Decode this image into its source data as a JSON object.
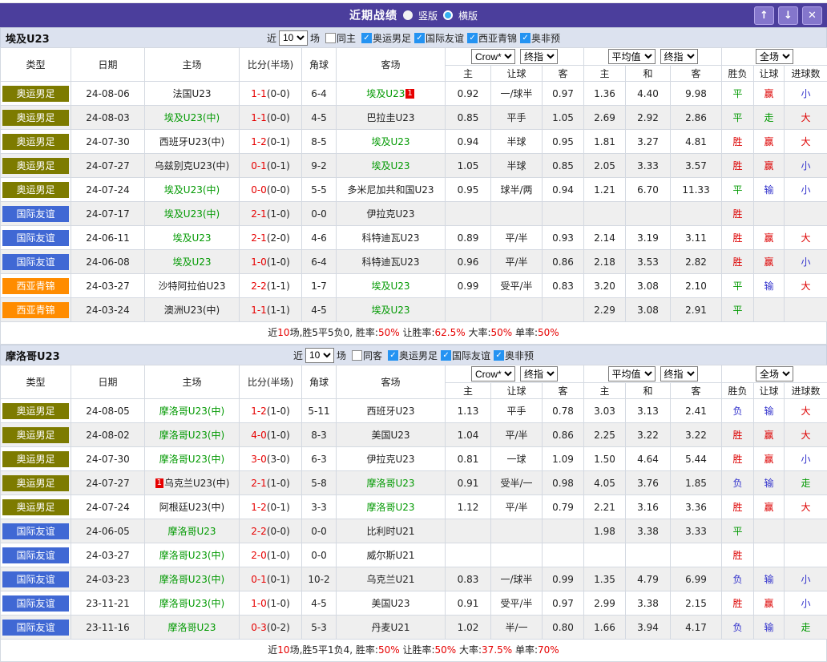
{
  "titlebar": {
    "title": "近期战绩",
    "vertical_label": "竖版",
    "horizontal_label": "横版",
    "up_icon": "↑",
    "down_icon": "↓",
    "close_icon": "✕"
  },
  "headers": {
    "type": "类型",
    "date": "日期",
    "home": "主场",
    "score": "比分(半场)",
    "corner": "角球",
    "away": "客场",
    "asian_home": "主",
    "asian_handicap": "让球",
    "asian_away": "客",
    "euro_home": "主",
    "euro_draw": "和",
    "euro_away": "客",
    "result_wdl": "胜负",
    "result_handicap": "让球",
    "result_goals": "进球数",
    "bookmaker_select": "Crow*",
    "final_select": "终指",
    "average_select": "平均值",
    "final_select2": "终指",
    "scope_select": "全场"
  },
  "filter_common": {
    "near": "近",
    "count": "10",
    "games": "场"
  },
  "result_colors": {
    "胜": "#dd0000",
    "平": "#009900",
    "负": "#3333cc",
    "赢": "#dd0000",
    "走": "#009900",
    "输": "#3333cc",
    "大": "#dd0000",
    "小": "#3333cc"
  },
  "type_colors": {
    "奥运男足": "#7d7b00",
    "国际友谊": "#4068d4",
    "西亚青锦": "#ff8c00"
  },
  "sections": [
    {
      "team": "埃及U23",
      "same_checkbox": {
        "label": "同主",
        "checked": false
      },
      "league_checkboxes": [
        {
          "label": "奥运男足",
          "checked": true
        },
        {
          "label": "国际友谊",
          "checked": true
        },
        {
          "label": "西亚青锦",
          "checked": true
        },
        {
          "label": "奥非预",
          "checked": true
        }
      ],
      "rows": [
        {
          "type": "奥运男足",
          "date": "24-08-06",
          "home": "法国U23",
          "home_green": false,
          "score": "1-1",
          "half": "(0-0)",
          "corner": "6-4",
          "away": "埃及U23",
          "away_green": true,
          "away_badge": "1",
          "asian": [
            "0.92",
            "一/球半",
            "0.97"
          ],
          "euro": [
            "1.36",
            "4.40",
            "9.98"
          ],
          "results": [
            "平",
            "赢",
            "小"
          ]
        },
        {
          "type": "奥运男足",
          "date": "24-08-03",
          "home": "埃及U23(中)",
          "home_green": true,
          "score": "1-1",
          "half": "(0-0)",
          "corner": "4-5",
          "away": "巴拉圭U23",
          "away_green": false,
          "asian": [
            "0.85",
            "平手",
            "1.05"
          ],
          "euro": [
            "2.69",
            "2.92",
            "2.86"
          ],
          "results": [
            "平",
            "走",
            "大"
          ]
        },
        {
          "type": "奥运男足",
          "date": "24-07-30",
          "home": "西班牙U23(中)",
          "home_green": false,
          "score": "1-2",
          "half": "(0-1)",
          "corner": "8-5",
          "away": "埃及U23",
          "away_green": true,
          "asian": [
            "0.94",
            "半球",
            "0.95"
          ],
          "euro": [
            "1.81",
            "3.27",
            "4.81"
          ],
          "results": [
            "胜",
            "赢",
            "大"
          ]
        },
        {
          "type": "奥运男足",
          "date": "24-07-27",
          "home": "乌兹别克U23(中)",
          "home_green": false,
          "score": "0-1",
          "half": "(0-1)",
          "corner": "9-2",
          "away": "埃及U23",
          "away_green": true,
          "asian": [
            "1.05",
            "半球",
            "0.85"
          ],
          "euro": [
            "2.05",
            "3.33",
            "3.57"
          ],
          "results": [
            "胜",
            "赢",
            "小"
          ]
        },
        {
          "type": "奥运男足",
          "date": "24-07-24",
          "home": "埃及U23(中)",
          "home_green": true,
          "score": "0-0",
          "half": "(0-0)",
          "corner": "5-5",
          "away": "多米尼加共和国U23",
          "away_green": false,
          "asian": [
            "0.95",
            "球半/两",
            "0.94"
          ],
          "euro": [
            "1.21",
            "6.70",
            "11.33"
          ],
          "results": [
            "平",
            "输",
            "小"
          ]
        },
        {
          "type": "国际友谊",
          "date": "24-07-17",
          "home": "埃及U23(中)",
          "home_green": true,
          "score": "2-1",
          "half": "(1-0)",
          "corner": "0-0",
          "away": "伊拉克U23",
          "away_green": false,
          "asian": [
            "",
            "",
            ""
          ],
          "euro": [
            "",
            "",
            ""
          ],
          "results": [
            "胜",
            "",
            ""
          ]
        },
        {
          "type": "国际友谊",
          "date": "24-06-11",
          "home": "埃及U23",
          "home_green": true,
          "score": "2-1",
          "half": "(2-0)",
          "corner": "4-6",
          "away": "科特迪瓦U23",
          "away_green": false,
          "asian": [
            "0.89",
            "平/半",
            "0.93"
          ],
          "euro": [
            "2.14",
            "3.19",
            "3.11"
          ],
          "results": [
            "胜",
            "赢",
            "大"
          ]
        },
        {
          "type": "国际友谊",
          "date": "24-06-08",
          "home": "埃及U23",
          "home_green": true,
          "score": "1-0",
          "half": "(1-0)",
          "corner": "6-4",
          "away": "科特迪瓦U23",
          "away_green": false,
          "asian": [
            "0.96",
            "平/半",
            "0.86"
          ],
          "euro": [
            "2.18",
            "3.53",
            "2.82"
          ],
          "results": [
            "胜",
            "赢",
            "小"
          ]
        },
        {
          "type": "西亚青锦",
          "date": "24-03-27",
          "home": "沙特阿拉伯U23",
          "home_green": false,
          "score": "2-2",
          "half": "(1-1)",
          "corner": "1-7",
          "away": "埃及U23",
          "away_green": true,
          "asian": [
            "0.99",
            "受平/半",
            "0.83"
          ],
          "euro": [
            "3.20",
            "3.08",
            "2.10"
          ],
          "results": [
            "平",
            "输",
            "大"
          ]
        },
        {
          "type": "西亚青锦",
          "date": "24-03-24",
          "home": "澳洲U23(中)",
          "home_green": false,
          "score": "1-1",
          "half": "(1-1)",
          "corner": "4-5",
          "away": "埃及U23",
          "away_green": true,
          "asian": [
            "",
            "",
            ""
          ],
          "euro": [
            "2.29",
            "3.08",
            "2.91"
          ],
          "results": [
            "平",
            "",
            ""
          ]
        }
      ],
      "summary": [
        {
          "text": "近"
        },
        {
          "text": "10",
          "red": true
        },
        {
          "text": "场,胜5平5负0, 胜率:"
        },
        {
          "text": "50%",
          "red": true
        },
        {
          "text": " 让胜率:"
        },
        {
          "text": "62.5%",
          "red": true
        },
        {
          "text": " 大率:"
        },
        {
          "text": "50%",
          "red": true
        },
        {
          "text": " 单率:"
        },
        {
          "text": "50%",
          "red": true
        }
      ]
    },
    {
      "team": "摩洛哥U23",
      "same_checkbox": {
        "label": "同客",
        "checked": false
      },
      "league_checkboxes": [
        {
          "label": "奥运男足",
          "checked": true
        },
        {
          "label": "国际友谊",
          "checked": true
        },
        {
          "label": "奥非预",
          "checked": true
        }
      ],
      "rows": [
        {
          "type": "奥运男足",
          "date": "24-08-05",
          "home": "摩洛哥U23(中)",
          "home_green": true,
          "score": "1-2",
          "half": "(1-0)",
          "corner": "5-11",
          "away": "西班牙U23",
          "away_green": false,
          "asian": [
            "1.13",
            "平手",
            "0.78"
          ],
          "euro": [
            "3.03",
            "3.13",
            "2.41"
          ],
          "results": [
            "负",
            "输",
            "大"
          ]
        },
        {
          "type": "奥运男足",
          "date": "24-08-02",
          "home": "摩洛哥U23(中)",
          "home_green": true,
          "score": "4-0",
          "half": "(1-0)",
          "corner": "8-3",
          "away": "美国U23",
          "away_green": false,
          "asian": [
            "1.04",
            "平/半",
            "0.86"
          ],
          "euro": [
            "2.25",
            "3.22",
            "3.22"
          ],
          "results": [
            "胜",
            "赢",
            "大"
          ]
        },
        {
          "type": "奥运男足",
          "date": "24-07-30",
          "home": "摩洛哥U23(中)",
          "home_green": true,
          "score": "3-0",
          "half": "(3-0)",
          "corner": "6-3",
          "away": "伊拉克U23",
          "away_green": false,
          "asian": [
            "0.81",
            "一球",
            "1.09"
          ],
          "euro": [
            "1.50",
            "4.64",
            "5.44"
          ],
          "results": [
            "胜",
            "赢",
            "小"
          ]
        },
        {
          "type": "奥运男足",
          "date": "24-07-27",
          "home": "乌克兰U23(中)",
          "home_green": false,
          "home_badge": "1",
          "score": "2-1",
          "half": "(1-0)",
          "corner": "5-8",
          "away": "摩洛哥U23",
          "away_green": true,
          "asian": [
            "0.91",
            "受半/一",
            "0.98"
          ],
          "euro": [
            "4.05",
            "3.76",
            "1.85"
          ],
          "results": [
            "负",
            "输",
            "走"
          ]
        },
        {
          "type": "奥运男足",
          "date": "24-07-24",
          "home": "阿根廷U23(中)",
          "home_green": false,
          "score": "1-2",
          "half": "(0-1)",
          "corner": "3-3",
          "away": "摩洛哥U23",
          "away_green": true,
          "asian": [
            "1.12",
            "平/半",
            "0.79"
          ],
          "euro": [
            "2.21",
            "3.16",
            "3.36"
          ],
          "results": [
            "胜",
            "赢",
            "大"
          ]
        },
        {
          "type": "国际友谊",
          "date": "24-06-05",
          "home": "摩洛哥U23",
          "home_green": true,
          "score": "2-2",
          "half": "(0-0)",
          "corner": "0-0",
          "away": "比利时U21",
          "away_green": false,
          "asian": [
            "",
            "",
            ""
          ],
          "euro": [
            "1.98",
            "3.38",
            "3.33"
          ],
          "results": [
            "平",
            "",
            ""
          ]
        },
        {
          "type": "国际友谊",
          "date": "24-03-27",
          "home": "摩洛哥U23(中)",
          "home_green": true,
          "score": "2-0",
          "half": "(1-0)",
          "corner": "0-0",
          "away": "威尔斯U21",
          "away_green": false,
          "asian": [
            "",
            "",
            ""
          ],
          "euro": [
            "",
            "",
            ""
          ],
          "results": [
            "胜",
            "",
            ""
          ]
        },
        {
          "type": "国际友谊",
          "date": "24-03-23",
          "home": "摩洛哥U23(中)",
          "home_green": true,
          "score": "0-1",
          "half": "(0-1)",
          "corner": "10-2",
          "away": "乌克兰U21",
          "away_green": false,
          "asian": [
            "0.83",
            "一/球半",
            "0.99"
          ],
          "euro": [
            "1.35",
            "4.79",
            "6.99"
          ],
          "results": [
            "负",
            "输",
            "小"
          ]
        },
        {
          "type": "国际友谊",
          "date": "23-11-21",
          "home": "摩洛哥U23(中)",
          "home_green": true,
          "score": "1-0",
          "half": "(1-0)",
          "corner": "4-5",
          "away": "美国U23",
          "away_green": false,
          "asian": [
            "0.91",
            "受平/半",
            "0.97"
          ],
          "euro": [
            "2.99",
            "3.38",
            "2.15"
          ],
          "results": [
            "胜",
            "赢",
            "小"
          ]
        },
        {
          "type": "国际友谊",
          "date": "23-11-16",
          "home": "摩洛哥U23",
          "home_green": true,
          "score": "0-3",
          "half": "(0-2)",
          "corner": "5-3",
          "away": "丹麦U21",
          "away_green": false,
          "asian": [
            "1.02",
            "半/一",
            "0.80"
          ],
          "euro": [
            "1.66",
            "3.94",
            "4.17"
          ],
          "results": [
            "负",
            "输",
            "走"
          ]
        }
      ],
      "summary": [
        {
          "text": "近"
        },
        {
          "text": "10",
          "red": true
        },
        {
          "text": "场,胜5平1负4, 胜率:"
        },
        {
          "text": "50%",
          "red": true
        },
        {
          "text": " 让胜率:"
        },
        {
          "text": "50%",
          "red": true
        },
        {
          "text": " 大率:"
        },
        {
          "text": "37.5%",
          "red": true
        },
        {
          "text": " 单率:"
        },
        {
          "text": "70%",
          "red": true
        }
      ]
    }
  ]
}
